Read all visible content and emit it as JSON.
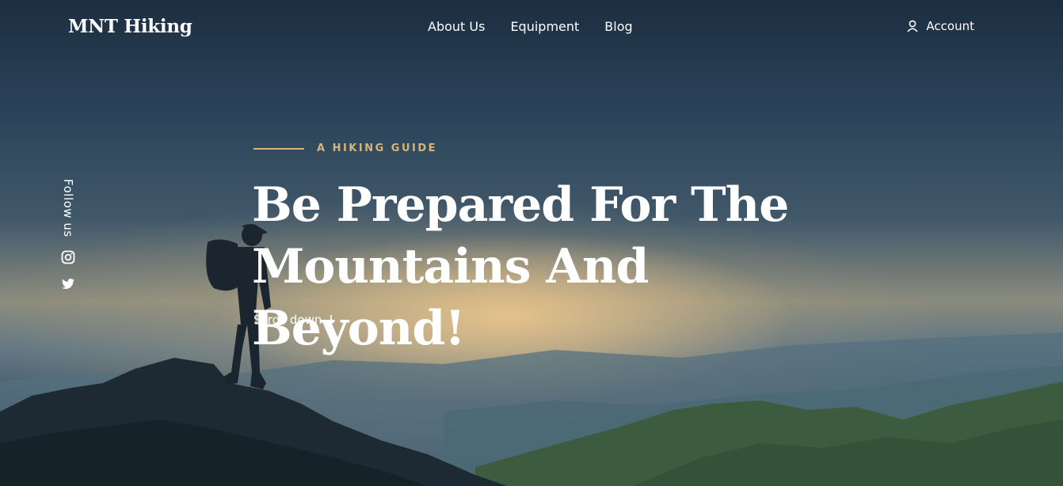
{
  "brand": {
    "name": "MNT Hiking"
  },
  "nav": {
    "links": [
      "About Us",
      "Equipment",
      "Blog"
    ],
    "account_label": "Account"
  },
  "social": {
    "label": "Follow us",
    "icons": [
      "instagram-icon",
      "twitter-icon"
    ]
  },
  "hero": {
    "eyebrow": "A HIKING GUIDE",
    "headline_line1": "Be Prepared For The",
    "headline_line2": "Mountains And Beyond!",
    "scroll_label": "Scroll down",
    "scroll_icon": "arrow-down-icon"
  },
  "colors": {
    "accent": "#d8b47a",
    "text": "#ffffff"
  }
}
